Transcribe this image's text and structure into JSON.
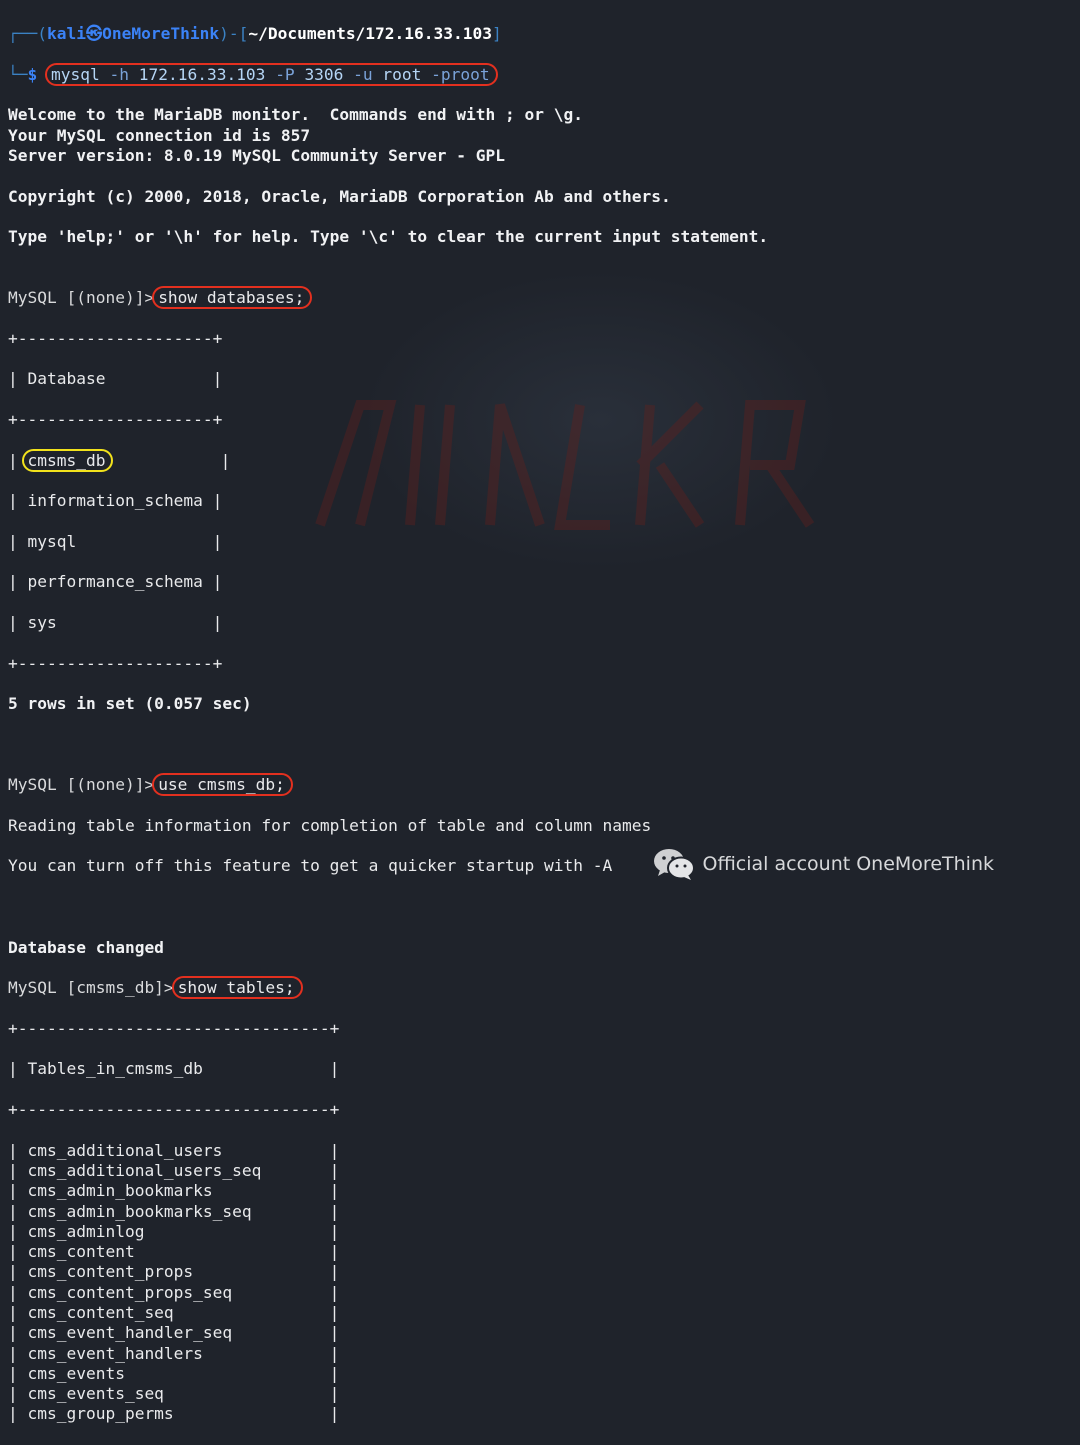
{
  "prompt_header": {
    "user": "kali",
    "separator_symbol": "㉿",
    "host": "OneMoreThink",
    "path": "~/Documents/172.16.33.103"
  },
  "command1": {
    "prefix": "$",
    "text": "mysql -h 172.16.33.103 -P 3306 -u root -proot"
  },
  "banner": [
    "Welcome to the MariaDB monitor.  Commands end with ; or \\g.",
    "Your MySQL connection id is 857",
    "Server version: 8.0.19 MySQL Community Server - GPL",
    "",
    "Copyright (c) 2000, 2018, Oracle, MariaDB Corporation Ab and others.",
    "",
    "Type 'help;' or '\\h' for help. Type '\\c' to clear the current input statement.",
    ""
  ],
  "query1": {
    "prompt": "MySQL [(none)]>",
    "command": "show databases;"
  },
  "db_table": {
    "border": "+--------------------+",
    "header": "| Database           |",
    "rows": [
      {
        "pipe": "|",
        "name": "cmsms_db",
        "pad": "           |"
      },
      {
        "pipe": "|",
        "name": "information_schema",
        "pad": " |"
      },
      {
        "pipe": "|",
        "name": "mysql",
        "pad": "              |"
      },
      {
        "pipe": "|",
        "name": "performance_schema",
        "pad": " |"
      },
      {
        "pipe": "|",
        "name": "sys",
        "pad": "                |"
      }
    ],
    "summary": "5 rows in set (0.057 sec)"
  },
  "query2": {
    "prompt": "MySQL [(none)]>",
    "command": "use cmsms_db;",
    "output": [
      "Reading table information for completion of table and column names",
      "You can turn off this feature to get a quicker startup with -A",
      ""
    ],
    "status": "Database changed"
  },
  "query3": {
    "prompt": "MySQL [cmsms_db]>",
    "command": "show tables;"
  },
  "tables_table": {
    "border": "+--------------------------------+",
    "header": "| Tables_in_cmsms_db             |",
    "rows": [
      "| cms_additional_users           |",
      "| cms_additional_users_seq       |",
      "| cms_admin_bookmarks            |",
      "| cms_admin_bookmarks_seq        |",
      "| cms_adminlog                   |",
      "| cms_content                    |",
      "| cms_content_props              |",
      "| cms_content_props_seq          |",
      "| cms_content_seq                |",
      "| cms_event_handler_seq          |",
      "| cms_event_handlers             |",
      "| cms_events                     |",
      "| cms_events_seq                 |",
      "| cms_group_perms                |"
    ]
  },
  "watermark": {
    "icon": "wechat-icon",
    "text": "Official account OneMoreThink"
  },
  "colors": {
    "background": "#1f232b",
    "highlight_red": "#e3301f",
    "highlight_yellow": "#f2e21c",
    "prompt_blue": "#3b82f6"
  }
}
